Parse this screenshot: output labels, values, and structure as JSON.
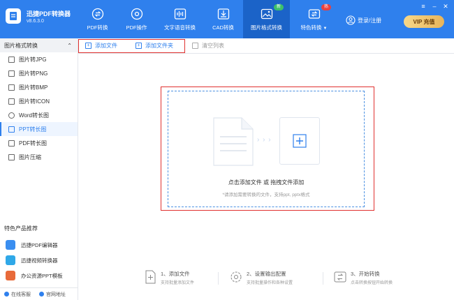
{
  "app": {
    "name": "迅捷PDF转换器",
    "version": "v8.6.3.0"
  },
  "nav": [
    {
      "label": "PDF转换",
      "icon": "convert-icon"
    },
    {
      "label": "PDF操作",
      "icon": "settings-icon"
    },
    {
      "label": "文字语音转换",
      "icon": "audio-wave-icon"
    },
    {
      "label": "CAD转换",
      "icon": "cad-icon"
    },
    {
      "label": "图片格式转换",
      "icon": "image-icon",
      "badge": "新"
    },
    {
      "label": "特色转换",
      "icon": "special-convert-icon",
      "badge": "热"
    }
  ],
  "header": {
    "login_label": "登录/注册",
    "vip_label": "VIP 充值"
  },
  "sidebar": {
    "heading": "图片格式转换",
    "items": [
      {
        "label": "图片转JPG"
      },
      {
        "label": "图片转PNG"
      },
      {
        "label": "图片转BMP"
      },
      {
        "label": "图片转ICON"
      },
      {
        "label": "Word转长图"
      },
      {
        "label": "PPT转长图"
      },
      {
        "label": "PDF转长图"
      },
      {
        "label": "图片压缩"
      }
    ],
    "featured_title": "特色产品推荐",
    "products": [
      {
        "label": "迅捷PDF编辑器"
      },
      {
        "label": "迅捷视频转换器"
      },
      {
        "label": "办公资源PPT模板"
      }
    ],
    "footer": {
      "service": "在线客服",
      "website": "官网地址"
    }
  },
  "toolbar": {
    "add_file": "添加文件",
    "add_folder": "添加文件夹",
    "clear_list": "清空列表"
  },
  "dropzone": {
    "title": "点击添加文件 或 拖拽文件添加",
    "subtitle": "*请添加需要转换的文件，支持ppt, pptx格式",
    "arrows": "› › ›"
  },
  "steps": [
    {
      "title": "1、添加文件",
      "desc": "支持批量添加文件"
    },
    {
      "title": "2、设置输出配置",
      "desc": "支持批量操作和各种设置"
    },
    {
      "title": "3、开始转换",
      "desc": "点击转换按钮开始转换"
    }
  ],
  "colors": {
    "primary": "#2f80ed",
    "highlight": "#e0312f",
    "badge_new": "#3cc06a",
    "badge_hot": "#e94040"
  }
}
